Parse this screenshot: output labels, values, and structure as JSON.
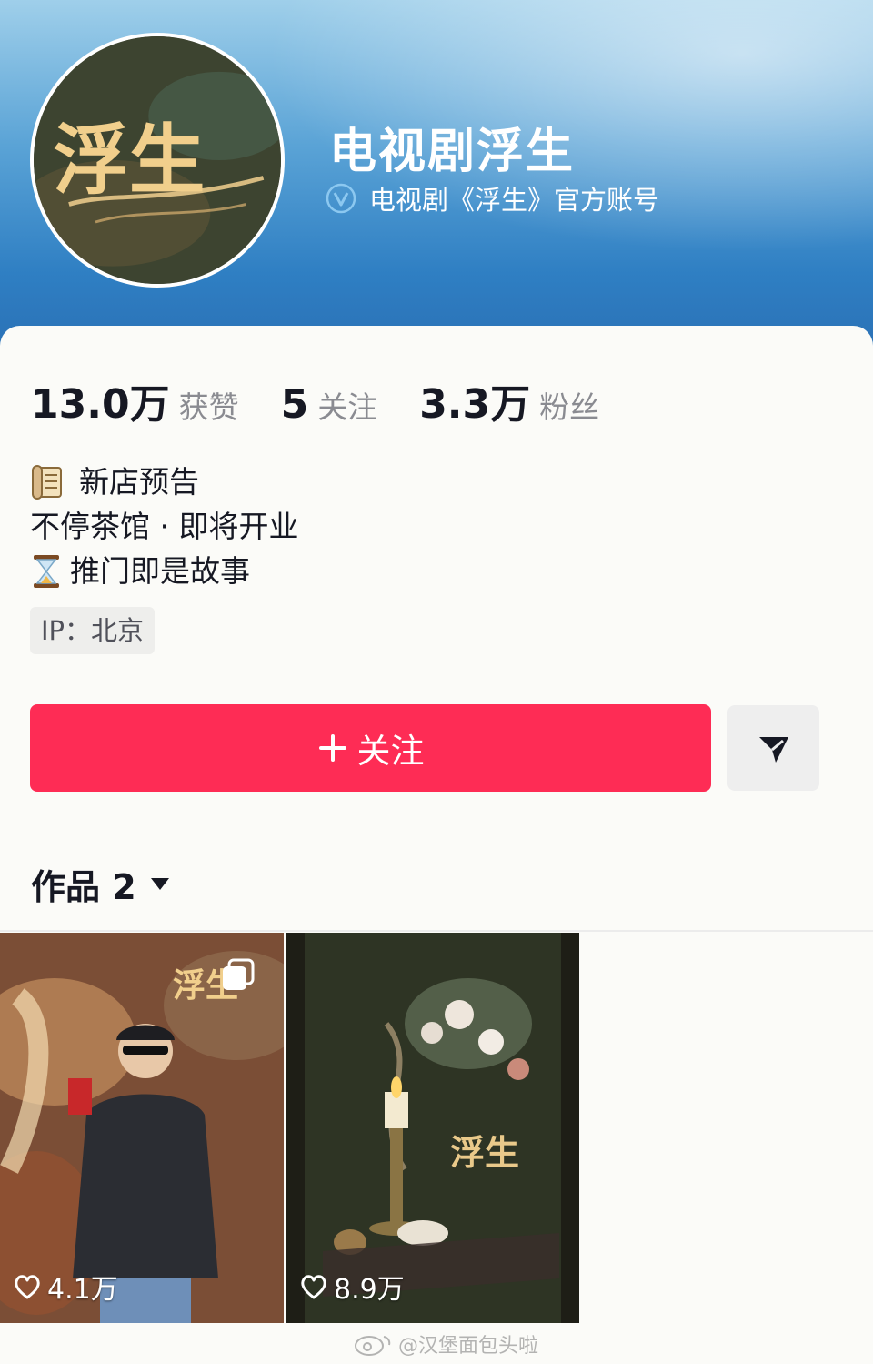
{
  "profile": {
    "name": "电视剧浮生",
    "verification": "电视剧《浮生》官方账号",
    "avatar_logo_text": "浮生"
  },
  "stats": [
    {
      "value": "13.0万",
      "label": "获赞"
    },
    {
      "value": "5",
      "label": "关注"
    },
    {
      "value": "3.3万",
      "label": "粉丝"
    }
  ],
  "bio": {
    "line1": "新店预告",
    "line2": "不停茶馆 · 即将开业",
    "line3": "推门即是故事"
  },
  "ip_tag": "IP：北京",
  "actions": {
    "follow_label": "关注"
  },
  "works": {
    "tab_label": "作品 2",
    "items": [
      {
        "likes": "4.1万"
      },
      {
        "likes": "8.9万"
      }
    ]
  },
  "watermark": "@汉堡面包头啦",
  "colors": {
    "accent": "#fe2c55",
    "header": "#2f7fc3",
    "verify": "#6fb4e8"
  }
}
